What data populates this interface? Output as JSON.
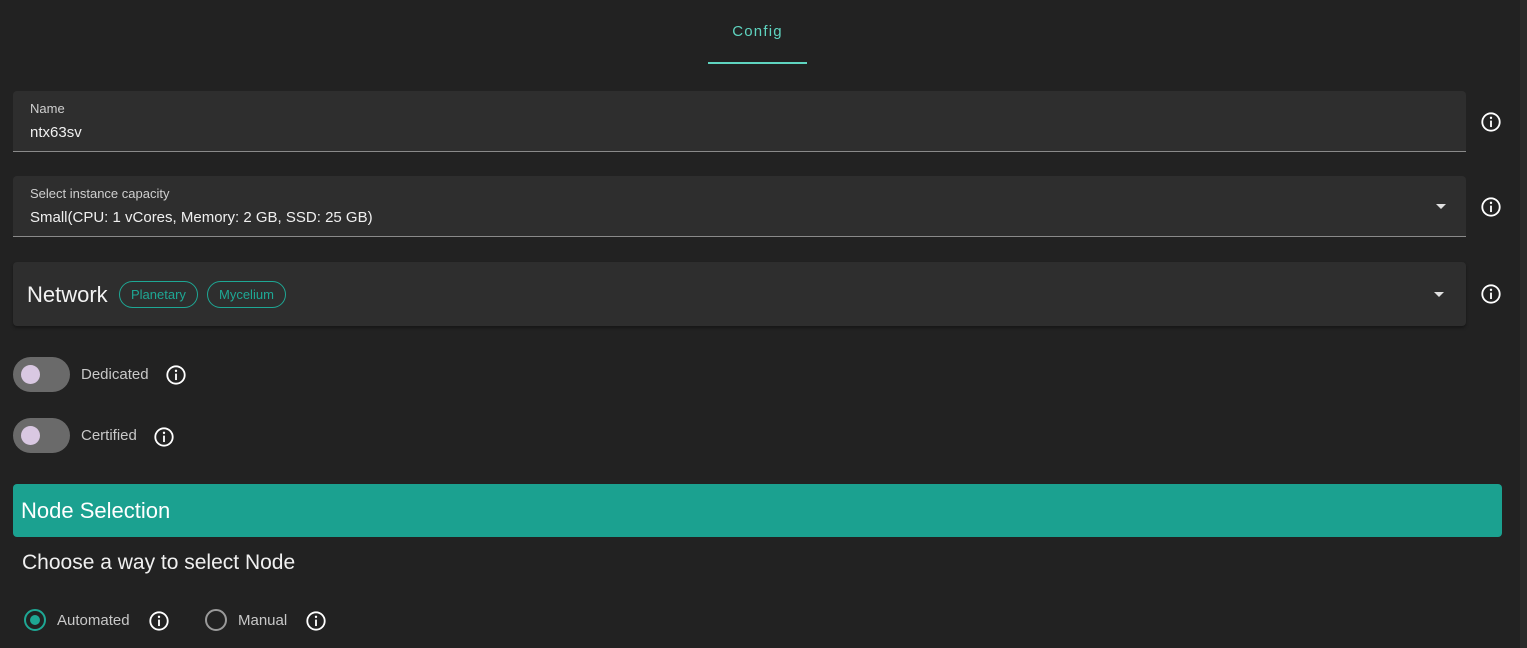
{
  "tabs": [
    {
      "label": "Config"
    }
  ],
  "name_field": {
    "label": "Name",
    "value": "ntx63sv"
  },
  "capacity_field": {
    "label": "Select instance capacity",
    "value": "Small(CPU: 1 vCores, Memory: 2 GB, SSD: 25 GB)"
  },
  "network": {
    "title": "Network",
    "chips": [
      "Planetary",
      "Mycelium"
    ]
  },
  "switches": {
    "dedicated": {
      "label": "Dedicated",
      "checked": false
    },
    "certified": {
      "label": "Certified",
      "checked": false
    }
  },
  "node_selection": {
    "title": "Node Selection",
    "subtitle": "Choose a way to select Node",
    "options": [
      {
        "label": "Automated",
        "selected": true
      },
      {
        "label": "Manual",
        "selected": false
      }
    ]
  },
  "colors": {
    "accent": "#1ea794",
    "tab_accent": "#5fd4c0",
    "header_bg": "#1ba190",
    "page_bg": "#222222"
  },
  "icons": {
    "info": "info-circle-icon",
    "dropdown": "caret-down-icon"
  }
}
